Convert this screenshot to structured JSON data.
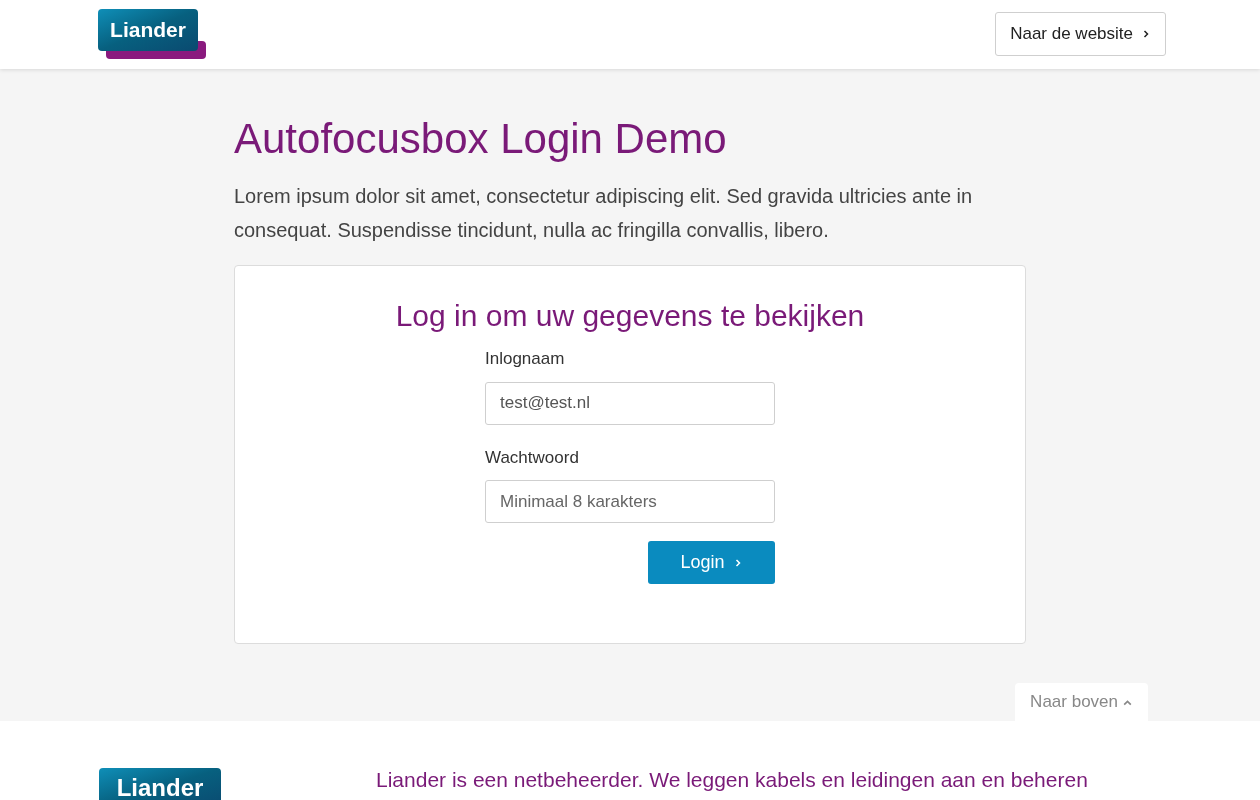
{
  "header": {
    "logo": "Liander",
    "website_button": "Naar de website"
  },
  "page": {
    "title": "Autofocusbox Login Demo",
    "intro": "Lorem ipsum dolor sit amet, consectetur adipiscing elit. Sed gravida ultricies ante in consequat. Suspendisse tincidunt, nulla ac fringilla convallis, libero."
  },
  "login_card": {
    "heading": "Log in om uw gegevens te bekijken",
    "fields": [
      {
        "label": "Inlognaam",
        "value": "test@test.nl"
      },
      {
        "label": "Wachtwoord",
        "placeholder": "Minimaal 8 karakters"
      }
    ],
    "submit": "Login"
  },
  "back_to_top": "Naar boven",
  "footer": {
    "logo": "Liander",
    "text": "Liander is een netbeheerder. We leggen kabels en leidingen aan en beheren"
  }
}
